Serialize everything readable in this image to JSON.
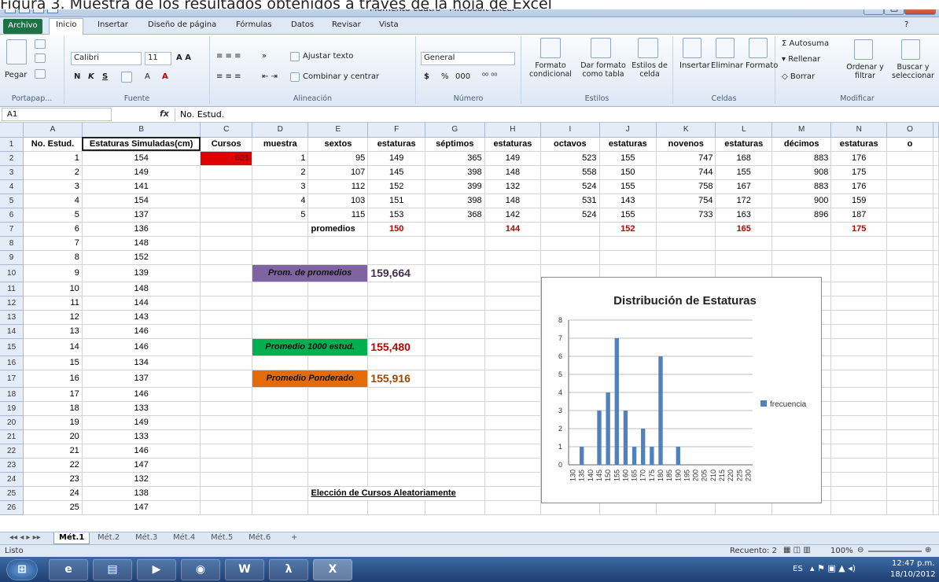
{
  "caption": "Figura 3. Muestra de los resultados obtenidos a través de la hoja de Excel",
  "window": {
    "title": "Momento cuatro - Microsoft Excel"
  },
  "tabs": [
    "Archivo",
    "Inicio",
    "Insertar",
    "Diseño de página",
    "Fórmulas",
    "Datos",
    "Revisar",
    "Vista"
  ],
  "ribbon": {
    "pegar": "Pegar",
    "portapapeles": "Portapap...",
    "font_name": "Calibri",
    "font_size": "11",
    "fuente": "Fuente",
    "ajustar": "Ajustar texto",
    "combinar": "Combinar y centrar",
    "alineacion": "Alineación",
    "formato_num": "General",
    "numero": "Número",
    "currency": "$",
    "percent": "%",
    "thousands": "000",
    "formato_cond": "Formato condicional",
    "dar_formato": "Dar formato como tabla",
    "estilos_celda": "Estilos de celda",
    "estilos": "Estilos",
    "insertar": "Insertar",
    "eliminar": "Eliminar",
    "formato": "Formato",
    "celdas": "Celdas",
    "autosuma": "Autosuma",
    "rellenar": "Rellenar",
    "borrar": "Borrar",
    "ordenar": "Ordenar y filtrar",
    "buscar": "Buscar y seleccionar",
    "modificar": "Modificar"
  },
  "formula_bar": {
    "name_box": "A1",
    "fx": "fx",
    "value": "No. Estud."
  },
  "columns": [
    "A",
    "B",
    "C",
    "D",
    "E",
    "F",
    "G",
    "H",
    "I",
    "J",
    "K",
    "L",
    "M",
    "N",
    "O"
  ],
  "headers": [
    "No. Estud.",
    "Estaturas Simuladas(cm)",
    "Cursos",
    "muestra",
    "sextos",
    "estaturas",
    "séptimos",
    "estaturas",
    "octavos",
    "estaturas",
    "novenos",
    "estaturas",
    "décimos",
    "estaturas",
    "o"
  ],
  "col_a": [
    "1",
    "2",
    "3",
    "4",
    "5",
    "6",
    "7",
    "8",
    "9",
    "10",
    "11",
    "12",
    "13",
    "14",
    "15",
    "16",
    "17",
    "18",
    "19",
    "20",
    "21",
    "22",
    "23",
    "24",
    "25"
  ],
  "col_b": [
    "154",
    "149",
    "141",
    "154",
    "137",
    "136",
    "148",
    "152",
    "139",
    "148",
    "144",
    "143",
    "146",
    "146",
    "134",
    "137",
    "146",
    "133",
    "149",
    "133",
    "146",
    "147",
    "132",
    "138",
    "147"
  ],
  "cursos_value": "601",
  "samples": [
    [
      "1",
      "95",
      "149",
      "365",
      "149",
      "523",
      "155",
      "747",
      "168",
      "883",
      "176"
    ],
    [
      "2",
      "107",
      "145",
      "398",
      "148",
      "558",
      "150",
      "744",
      "155",
      "908",
      "175"
    ],
    [
      "3",
      "112",
      "152",
      "399",
      "132",
      "524",
      "155",
      "758",
      "167",
      "883",
      "176"
    ],
    [
      "4",
      "103",
      "151",
      "398",
      "148",
      "531",
      "143",
      "754",
      "172",
      "900",
      "159"
    ],
    [
      "5",
      "115",
      "153",
      "368",
      "142",
      "524",
      "155",
      "733",
      "163",
      "896",
      "187"
    ]
  ],
  "promedios": {
    "label": "promedios",
    "sextos": "150",
    "septimos": "144",
    "octavos": "152",
    "novenos": "165",
    "decimos": "175"
  },
  "summary": [
    {
      "label": "Prom. de promedios",
      "value": "159,664",
      "color": "#8064a2"
    },
    {
      "label": "Promedio 1000 estud.",
      "value": "155,480",
      "color": "#00b050"
    },
    {
      "label": "Promedio Ponderado",
      "value": "155,916",
      "color": "#e36c09"
    }
  ],
  "eleccion": "Elección de Cursos Aleatoriamente",
  "sheets": [
    "Mét.1",
    "Mét.2",
    "Mét.3",
    "Mét.4",
    "Mét.5",
    "Mét.6"
  ],
  "status": {
    "ready": "Listo",
    "count": "Recuento: 2",
    "zoom": "100%"
  },
  "taskbar": {
    "lang": "ES",
    "time": "12:47 p.m.",
    "date": "18/10/2012"
  },
  "chart_data": {
    "type": "bar",
    "title": "Distribución de Estaturas",
    "categories": [
      "130",
      "135",
      "140",
      "145",
      "150",
      "155",
      "160",
      "165",
      "170",
      "175",
      "180",
      "185",
      "190",
      "195",
      "200",
      "205",
      "210",
      "215",
      "220",
      "225",
      "230"
    ],
    "series": [
      {
        "name": "frecuencia",
        "values": [
          0,
          1,
          0,
          3,
          4,
          7,
          3,
          1,
          2,
          1,
          6,
          0,
          1,
          0,
          0,
          0,
          0,
          0,
          0,
          0,
          0
        ]
      }
    ],
    "ylim": [
      0,
      8
    ],
    "grid": true,
    "legend": "right",
    "color": "#4f81bd"
  }
}
